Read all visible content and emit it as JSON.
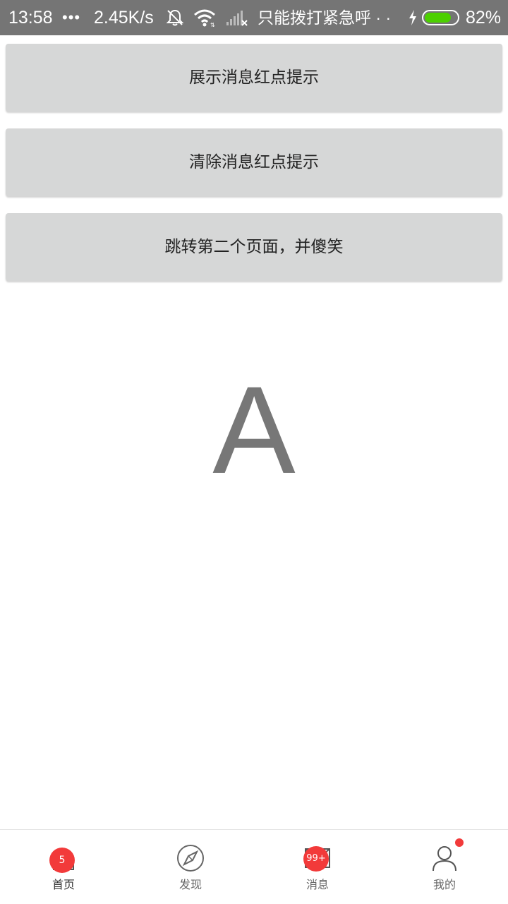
{
  "status_bar": {
    "time": "13:58",
    "dots": "•••",
    "net_speed": "2.45K/s",
    "carrier": "只能拨打紧急呼 · ·",
    "battery_pct": "82%",
    "battery_level": 0.82,
    "icons": [
      "bell-muted-icon",
      "wifi-icon",
      "signal-icon",
      "charging-bolt-icon",
      "battery-icon"
    ]
  },
  "buttons": {
    "show_badge": "展示消息红点提示",
    "clear_badge": "清除消息红点提示",
    "jump_page": "跳转第二个页面，并傻笑"
  },
  "content": {
    "big_letter": "A"
  },
  "bottom_nav": {
    "tabs": [
      {
        "label": "首页",
        "icon": "home-icon",
        "badge": "5",
        "active": true
      },
      {
        "label": "发现",
        "icon": "compass-icon",
        "badge": "",
        "active": false
      },
      {
        "label": "消息",
        "icon": "mail-icon",
        "badge": "99+",
        "active": false
      },
      {
        "label": "我的",
        "icon": "user-icon",
        "badge": "dot",
        "active": false
      }
    ]
  },
  "colors": {
    "status_bar_bg": "#757575",
    "button_bg": "#d6d7d7",
    "badge_red": "#f23a3a",
    "battery_green": "#4cd000"
  }
}
